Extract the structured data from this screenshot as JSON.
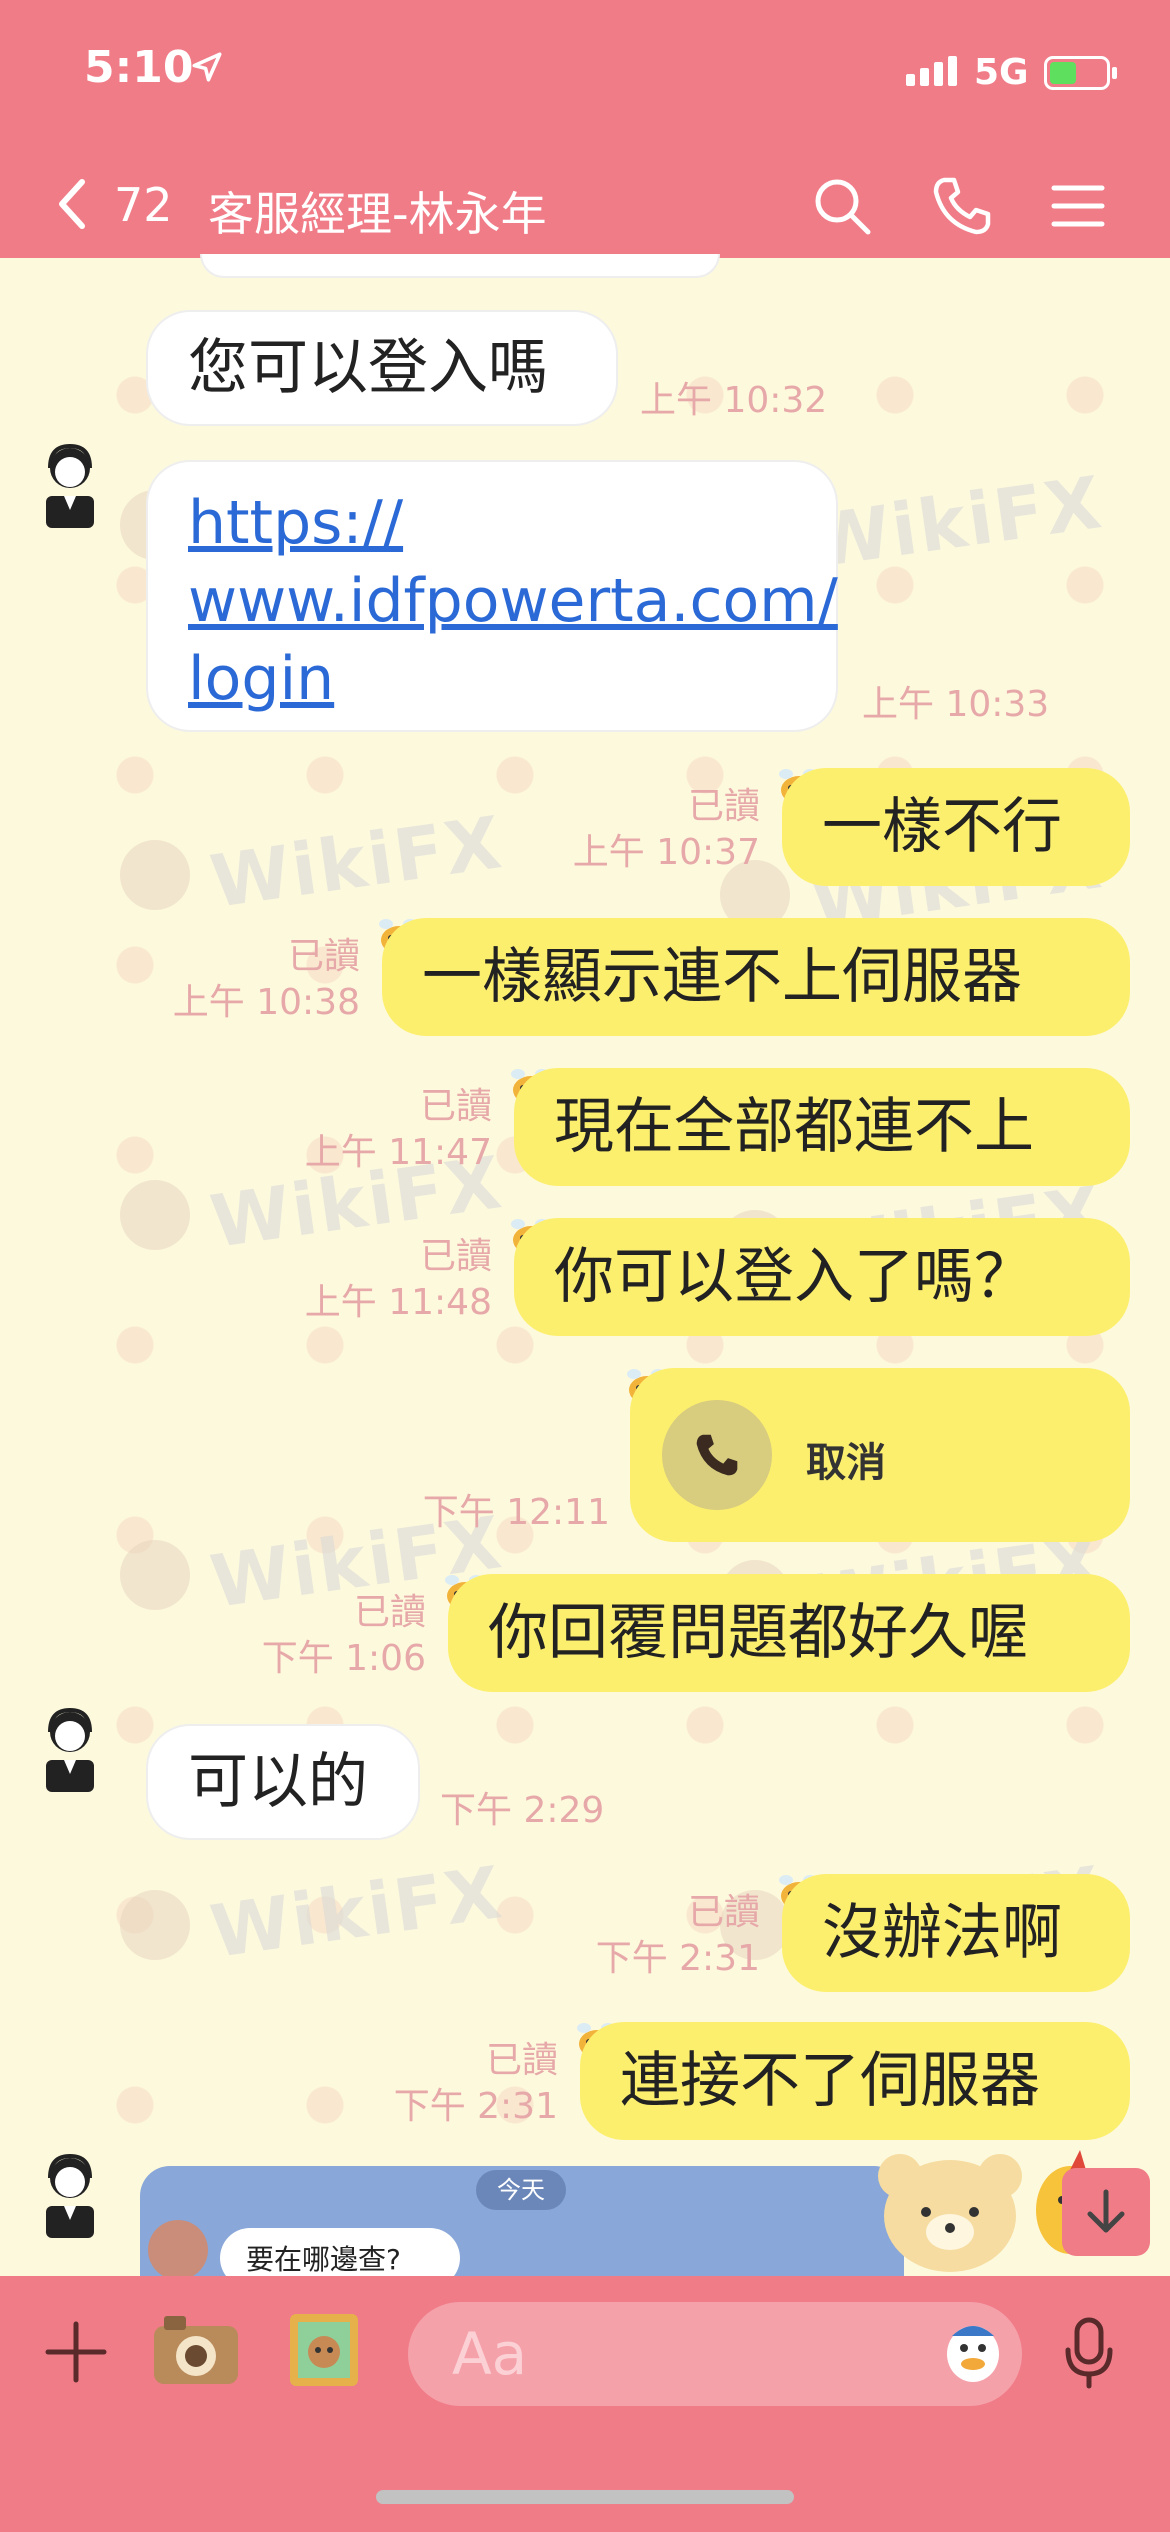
{
  "status_bar": {
    "time": "5:10",
    "network": "5G"
  },
  "header": {
    "unread_count": "72",
    "title": "客服經理-林永年"
  },
  "watermark": "WikiFX",
  "messages": [
    {
      "id": 1,
      "side": "in",
      "text": "您可以登入嗎",
      "time": "上午 10:32"
    },
    {
      "id": 2,
      "side": "in",
      "text_lines": [
        "https://",
        "www.idfpowerta.com/",
        "login"
      ],
      "time": "上午 10:33"
    },
    {
      "id": 3,
      "side": "out",
      "text": "一樣不行",
      "read": "已讀",
      "time": "上午 10:37"
    },
    {
      "id": 4,
      "side": "out",
      "text": "一樣顯示連不上伺服器",
      "read": "已讀",
      "time": "上午 10:38"
    },
    {
      "id": 5,
      "side": "out",
      "text": "現在全部都連不上",
      "read": "已讀",
      "time": "上午 11:47"
    },
    {
      "id": 6,
      "side": "out",
      "text": "你可以登入了嗎？",
      "read": "已讀",
      "time": "上午 11:48"
    },
    {
      "id": 7,
      "side": "out",
      "call_label": "取消",
      "time": "下午 12:11"
    },
    {
      "id": 8,
      "side": "out",
      "text": "你回覆問題都好久喔",
      "read": "已讀",
      "time": "下午 1:06"
    },
    {
      "id": 9,
      "side": "in",
      "text": "可以的",
      "time": "下午 2:29"
    },
    {
      "id": 10,
      "side": "out",
      "text": "沒辦法啊",
      "read": "已讀",
      "time": "下午 2:31"
    },
    {
      "id": 11,
      "side": "out",
      "text": "連接不了伺服器",
      "read": "已讀",
      "time": "下午 2:31"
    }
  ],
  "preview": {
    "date_label": "今天",
    "text": "要在哪邊查?"
  },
  "input": {
    "placeholder": "Aa"
  },
  "colors": {
    "header": "#f07c88",
    "background": "#fdf9dd",
    "outgoing": "#fdef6e",
    "incoming": "#ffffff",
    "meta": "#e6a8a8",
    "link": "#2b6ad6"
  }
}
